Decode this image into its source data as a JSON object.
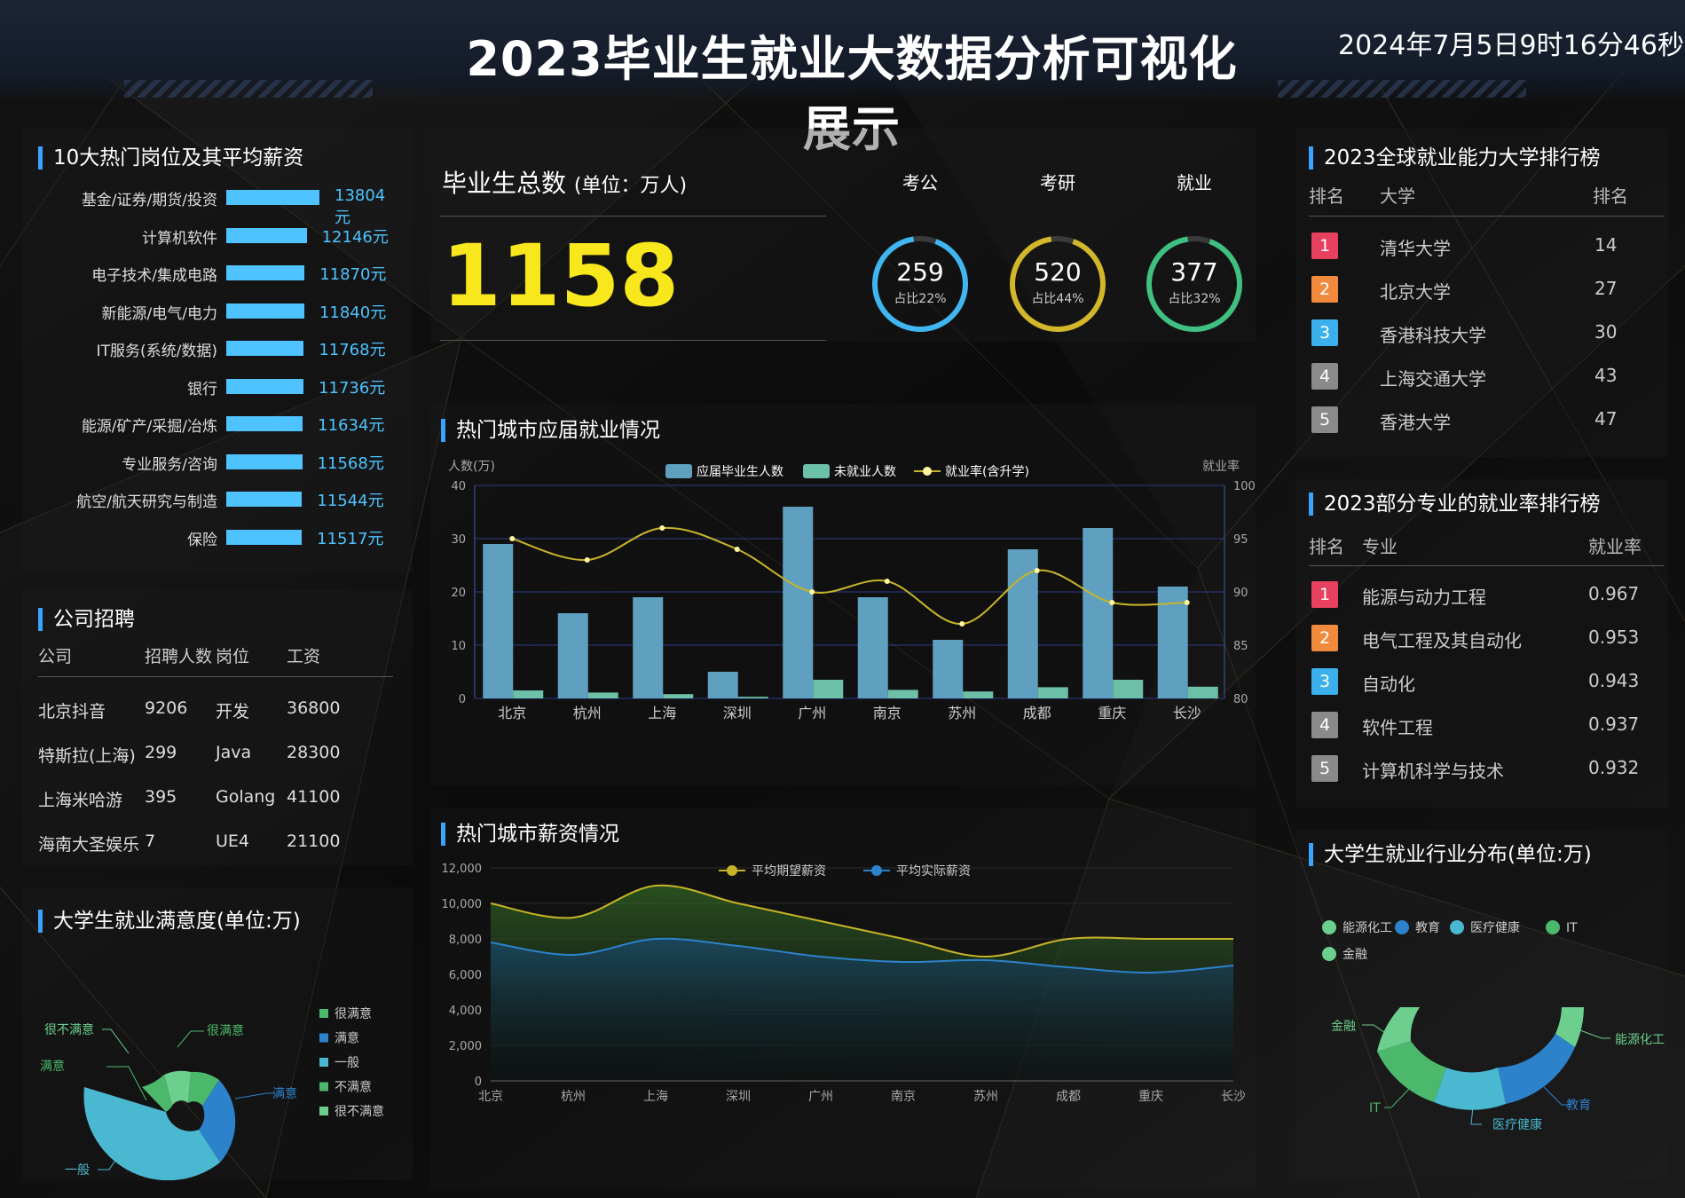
{
  "header": {
    "title": "2023毕业生就业大数据分析可视化展示",
    "datetime": "2024年7月5日9时16分46秒"
  },
  "hot_jobs": {
    "title": "10大热门岗位及其平均薪资",
    "items": [
      {
        "name": "基金/证券/期货/投资",
        "salary": 13804,
        "label": "13804元"
      },
      {
        "name": "计算机软件",
        "salary": 12146,
        "label": "12146元"
      },
      {
        "name": "电子技术/集成电路",
        "salary": 11870,
        "label": "11870元"
      },
      {
        "name": "新能源/电气/电力",
        "salary": 11840,
        "label": "11840元"
      },
      {
        "name": "IT服务(系统/数据)",
        "salary": 11768,
        "label": "11768元"
      },
      {
        "name": "银行",
        "salary": 11736,
        "label": "11736元"
      },
      {
        "name": "能源/矿产/采掘/冶炼",
        "salary": 11634,
        "label": "11634元"
      },
      {
        "name": "专业服务/咨询",
        "salary": 11568,
        "label": "11568元"
      },
      {
        "name": "航空/航天研究与制造",
        "salary": 11544,
        "label": "11544元"
      },
      {
        "name": "保险",
        "salary": 11517,
        "label": "11517元"
      }
    ]
  },
  "company": {
    "title": "公司招聘",
    "headers": [
      "公司",
      "招聘人数",
      "岗位",
      "工资"
    ],
    "rows": [
      [
        "北京抖音",
        "9206",
        "开发",
        "36800"
      ],
      [
        "特斯拉(上海)",
        "299",
        "Java",
        "28300"
      ],
      [
        "上海米哈游",
        "395",
        "Golang",
        "41100"
      ],
      [
        "海南大圣娱乐",
        "7",
        "UE4",
        "21100"
      ]
    ]
  },
  "satisfaction": {
    "title": "大学生就业满意度(单位:万)",
    "legend": [
      "很满意",
      "满意",
      "一般",
      "不满意",
      "很不满意"
    ],
    "labels": [
      "很不满意",
      "满意",
      "很满意",
      "满意",
      "一般"
    ],
    "colors": [
      "#4cb86b",
      "#2d82cc",
      "#4ab8d0",
      "#4cb86b",
      "#6ccf8e"
    ]
  },
  "total": {
    "label": "毕业生总数",
    "unit": "(单位：万人)",
    "value": "1158",
    "rings": [
      {
        "title": "考公",
        "value": "259",
        "pct_label": "占比22%",
        "pct": 0.22,
        "color": "#3fb6f0"
      },
      {
        "title": "考研",
        "value": "520",
        "pct_label": "占比44%",
        "pct": 0.44,
        "color": "#d3b72a"
      },
      {
        "title": "就业",
        "value": "377",
        "pct_label": "占比32%",
        "pct": 0.32,
        "color": "#3fbf80"
      }
    ]
  },
  "city_employment": {
    "title": "热门城市应届就业情况",
    "chart_data": {
      "type": "bar",
      "categories": [
        "北京",
        "杭州",
        "上海",
        "深圳",
        "广州",
        "南京",
        "苏州",
        "成都",
        "重庆",
        "长沙"
      ],
      "series": [
        {
          "name": "应届毕业生人数",
          "values": [
            29,
            16,
            19,
            5,
            36,
            19,
            11,
            28,
            32,
            21
          ]
        },
        {
          "name": "未就业人数",
          "values": [
            1.5,
            1.1,
            0.8,
            0.3,
            3.5,
            1.6,
            1.3,
            2.1,
            3.5,
            2.2
          ]
        },
        {
          "name": "就业率(含升学)",
          "values": [
            95,
            93,
            96,
            94,
            90,
            91,
            87,
            92,
            89,
            89
          ]
        }
      ],
      "ylabel": "人数(万)",
      "y2label": "就业率",
      "ylim": [
        0,
        40
      ],
      "y2lim": [
        80,
        100
      ],
      "yticks": [
        "0",
        "10",
        "20",
        "30",
        "40"
      ],
      "y2ticks": [
        "80",
        "85",
        "90",
        "95",
        "100"
      ],
      "grid": true,
      "legend": "top-center"
    }
  },
  "city_salary": {
    "title": "热门城市薪资情况",
    "chart_data": {
      "type": "area",
      "categories": [
        "北京",
        "杭州",
        "上海",
        "深圳",
        "广州",
        "南京",
        "苏州",
        "成都",
        "重庆",
        "长沙"
      ],
      "series": [
        {
          "name": "平均期望薪资",
          "values": [
            10000,
            9200,
            11000,
            10000,
            9000,
            8000,
            7000,
            8000,
            8000,
            8000
          ]
        },
        {
          "name": "平均实际薪资",
          "values": [
            7800,
            7100,
            8000,
            7600,
            7000,
            6700,
            6800,
            6400,
            6100,
            6500
          ]
        }
      ],
      "ylim": [
        0,
        12000
      ],
      "yticks": [
        "0",
        "2,000",
        "4,000",
        "6,000",
        "8,000",
        "10,000",
        "12,000"
      ],
      "grid": true,
      "legend": "top-center"
    }
  },
  "uni_rank": {
    "title": "2023全球就业能力大学排行榜",
    "headers": [
      "排名",
      "大学",
      "排名"
    ],
    "rows": [
      {
        "rank": "1",
        "name": "清华大学",
        "score": "14"
      },
      {
        "rank": "2",
        "name": "北京大学",
        "score": "27"
      },
      {
        "rank": "3",
        "name": "香港科技大学",
        "score": "30"
      },
      {
        "rank": "4",
        "name": "上海交通大学",
        "score": "43"
      },
      {
        "rank": "5",
        "name": "香港大学",
        "score": "47"
      }
    ]
  },
  "major_rank": {
    "title": "2023部分专业的就业率排行榜",
    "headers": [
      "排名",
      "专业",
      "就业率"
    ],
    "rows": [
      {
        "rank": "1",
        "name": "能源与动力工程",
        "score": "0.967"
      },
      {
        "rank": "2",
        "name": "电气工程及其自动化",
        "score": "0.953"
      },
      {
        "rank": "3",
        "name": "自动化",
        "score": "0.943"
      },
      {
        "rank": "4",
        "name": "软件工程",
        "score": "0.937"
      },
      {
        "rank": "5",
        "name": "计算机科学与技术",
        "score": "0.932"
      }
    ]
  },
  "rank_colors": [
    "#e8405f",
    "#f08a3c",
    "#3cb0ec",
    "#8a8a8a",
    "#8a8a8a"
  ],
  "industry": {
    "title": "大学生就业行业分布(单位:万)",
    "legend": [
      "能源化工",
      "教育",
      "医疗健康",
      "IT",
      "金融"
    ],
    "colors": [
      "#6ccf8e",
      "#2d82cc",
      "#4ab8d0",
      "#4cb86b",
      "#6ccf8e"
    ],
    "labels": [
      "金融",
      "能源化工",
      "IT",
      "教育",
      "医疗健康"
    ]
  }
}
